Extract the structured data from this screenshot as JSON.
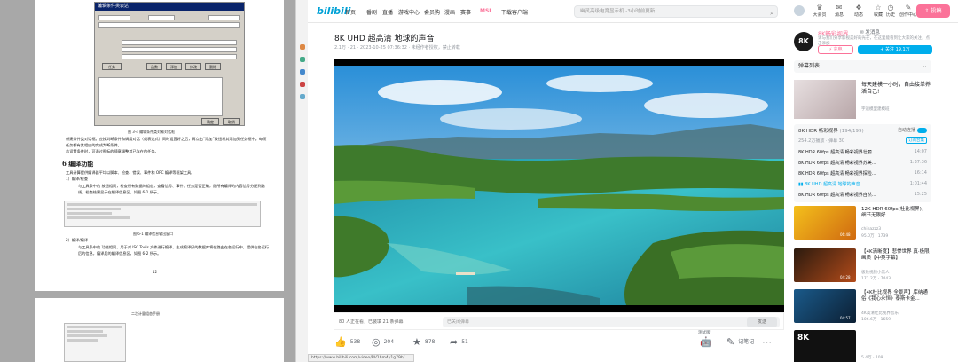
{
  "doc": {
    "dialog_title": "编辑条件类表达",
    "fig1_caption": "图 3-4 编辑条件类对象对话框",
    "para1": "新建条件类对话框。应按判断条件和调用对话（或表达式）同时设置好之后，再点击“添加”按钮将其添加到任务框中。每项任务都有其相应的完成判断条件。",
    "para2": "若设置条件时，可通过图标的随意调整其已存在的任务。",
    "section6": "6 编译功能",
    "section6_intro": "工具计算提供编译器平均以脚本、检查、错误、事件和 OPC 编译等框架工具。",
    "sub1": "1）编译/检查",
    "sub1_text": "与工具条中的 按钮相同，检查所有数据的组态，查看信号、事件、任务是否正确，即所有编译的内容信号分配到路线，检查结果显示在编译信息区，如图 6-1 所示。",
    "fig2_caption": "图 6-1 编译信息输出窗口",
    "sub2": "2）编译/编译",
    "sub2_text": "与工具条中的 功能相同，用于对 ISC Tools 文件进行编译，生成编译好的数据库将在路由在各运行中，提供在各运行后的信息，编译后的编译信息区，如图 6-2 所示。",
    "page_no": "12",
    "page2_header": "二次计量组态手册"
  },
  "browser": {
    "status_url": "https://www.bilibili.com/video/BV1hm4y1g79h/"
  },
  "bili": {
    "logo": "bilibili",
    "nav": [
      "首页",
      "番剧",
      "直播",
      "游戏中心",
      "会员购",
      "漫画",
      "赛事",
      "下载客户端"
    ],
    "search_placeholder": "幽灵高级电竞显示机 -3小时前更新",
    "topics": [
      "大会员",
      "消息",
      "动态",
      "收藏",
      "历史",
      "创作中心"
    ],
    "upload": "投稿",
    "badge_count": "99+",
    "video_title": "8K UHD 超高清 地球的声音",
    "meta": "2.1万 ·  21  ·  2023-10-25 07:36:32  ·  未经作者授权，禁止转载",
    "danmaku_count": "80 人正在看，已装填 21 条弹幕",
    "danmaku_placeholder": "已关闭弹幕",
    "send_label": "发送",
    "likes": "538",
    "coins": "204",
    "favs": "878",
    "shares": "51",
    "notes_label": "记笔记",
    "beta_label": "测试版"
  },
  "sidebar": {
    "up_name": "8K畅彩视界",
    "up_msg": "发消息",
    "up_desc": "请与我们分享影视美好的光芒，在这里能看到让大家的关注，点击添加~",
    "charge": "充电",
    "follow": "+ 关注 19.1万",
    "list_head": "弹幕列表",
    "ad_title": "每天建模一小时，自由接单养活自己!",
    "ad_tag": "宇速模型建模班",
    "coll_title": "8K HDR 畅彩视界",
    "coll_count": "(194/199)",
    "coll_auto": "自动连播",
    "coll_stats": "254.2万播放 · 弹幕 30",
    "coll_fav": "订阅合集",
    "episodes": [
      {
        "title": "8K HDR 60fps 超高清 畅彩视界壮丽...",
        "dur": "14:07"
      },
      {
        "title": "8K HDR 60fps 超高清 畅彩视界苏美...",
        "dur": "1:37:36"
      },
      {
        "title": "8K HDR 60fps 超高清 畅彩视界探险...",
        "dur": "16:14"
      },
      {
        "title": "8K UHD 超高清 地球的声音",
        "dur": "1:01:44"
      },
      {
        "title": "8K HDR 60fps 超高清 畅彩视界自然...",
        "dur": "15:25"
      },
      {
        "title": "8K HDR 60fps 超高清 畅彩视界欧洲...",
        "dur": "17:13"
      }
    ],
    "recs": [
      {
        "title": "12K HDR 60fps(杜比视界)，细节无限好",
        "up": "chinazzz3",
        "stats": "95.0万 · 1739",
        "dur": "06:48"
      },
      {
        "title": "【4K清晰度】悲惨世界 真·极限画质【中英字幕】",
        "up": "极致视频小黑人",
        "stats": "171.2万 · 7443",
        "dur": "04:28"
      },
      {
        "title": "【4K杜比视界 全景声】库纳通俗《我心永恒》泰斯卡金...",
        "up": "4K高清杜比视界音乐",
        "stats": "106.6万 · 1659",
        "dur": "04:57"
      },
      {
        "title": "",
        "up": "",
        "stats": "5.4万 · 109",
        "dur": ""
      }
    ]
  }
}
